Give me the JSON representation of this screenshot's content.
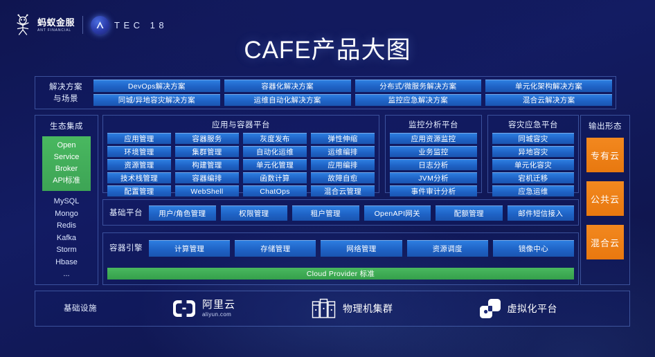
{
  "header": {
    "ant_logo_cn": "蚂蚁金服",
    "ant_logo_en": "ANT FINANCIAL",
    "atec_text": "TEC 18",
    "atec_badge_icon": "atec-a-icon"
  },
  "title": "CAFE产品大图",
  "solutions": {
    "label": "解决方案\n与场景",
    "label_line1": "解决方案",
    "label_line2": "与场景",
    "row1": [
      "DevOps解决方案",
      "容器化解决方案",
      "分布式/微服务解决方案",
      "单元化架构解决方案"
    ],
    "row2": [
      "同城/异地容灾解决方案",
      "运维自动化解决方案",
      "监控应急解决方案",
      "混合云解决方案"
    ]
  },
  "ecosystem": {
    "title": "生态集成",
    "osb_lines": [
      "Open",
      "Service",
      "Broker",
      "API标准"
    ],
    "osb_color": "#3da455",
    "items": [
      "MySQL",
      "Mongo",
      "Redis",
      "Kafka",
      "Storm",
      "Hbase",
      "..."
    ]
  },
  "app_platform": {
    "title": "应用与容器平台",
    "items": [
      "应用管理",
      "容器服务",
      "灰度发布",
      "弹性伸缩",
      "环境管理",
      "集群管理",
      "自动化运维",
      "运维编排",
      "资源管理",
      "构建管理",
      "单元化管理",
      "应用编排",
      "技术栈管理",
      "容器编排",
      "函数计算",
      "故障自愈",
      "配置管理",
      "WebShell",
      "ChatOps",
      "混合云管理"
    ]
  },
  "monitor_platform": {
    "title": "监控分析平台",
    "items": [
      "应用资源监控",
      "业务监控",
      "日志分析",
      "JVM分析",
      "事件审计分析"
    ]
  },
  "dr_platform": {
    "title": "容灾应急平台",
    "items": [
      "同城容灾",
      "异地容灾",
      "单元化容灾",
      "宕机迁移",
      "应急运维"
    ]
  },
  "output": {
    "title": "输出形态",
    "accent_color": "#e8780f",
    "items": [
      "专有云",
      "公共云",
      "混合云"
    ]
  },
  "base_platform": {
    "label": "基础平台",
    "items": [
      "用户/角色管理",
      "权限管理",
      "租户管理",
      "OpenAPI网关",
      "配额管理",
      "邮件短信接入"
    ]
  },
  "container_engine": {
    "label": "容器引擎",
    "items": [
      "计算管理",
      "存储管理",
      "网络管理",
      "资源调度",
      "镜像中心"
    ],
    "cloud_provider_bar": "Cloud Provider 标准",
    "cloud_provider_color": "#3da455"
  },
  "infrastructure": {
    "label": "基础设施",
    "items": [
      {
        "caption_cn": "阿里云",
        "caption_en": "aliyun.com",
        "icon": "aliyun-logo-icon"
      },
      {
        "caption_cn": "物理机集群",
        "icon": "server-rack-icon"
      },
      {
        "caption_cn": "虚拟化平台",
        "icon": "virtualization-icon"
      }
    ]
  },
  "colors": {
    "chip_blue": "#1f63c6",
    "panel_border": "#78a0f5",
    "background": "#131c63"
  }
}
